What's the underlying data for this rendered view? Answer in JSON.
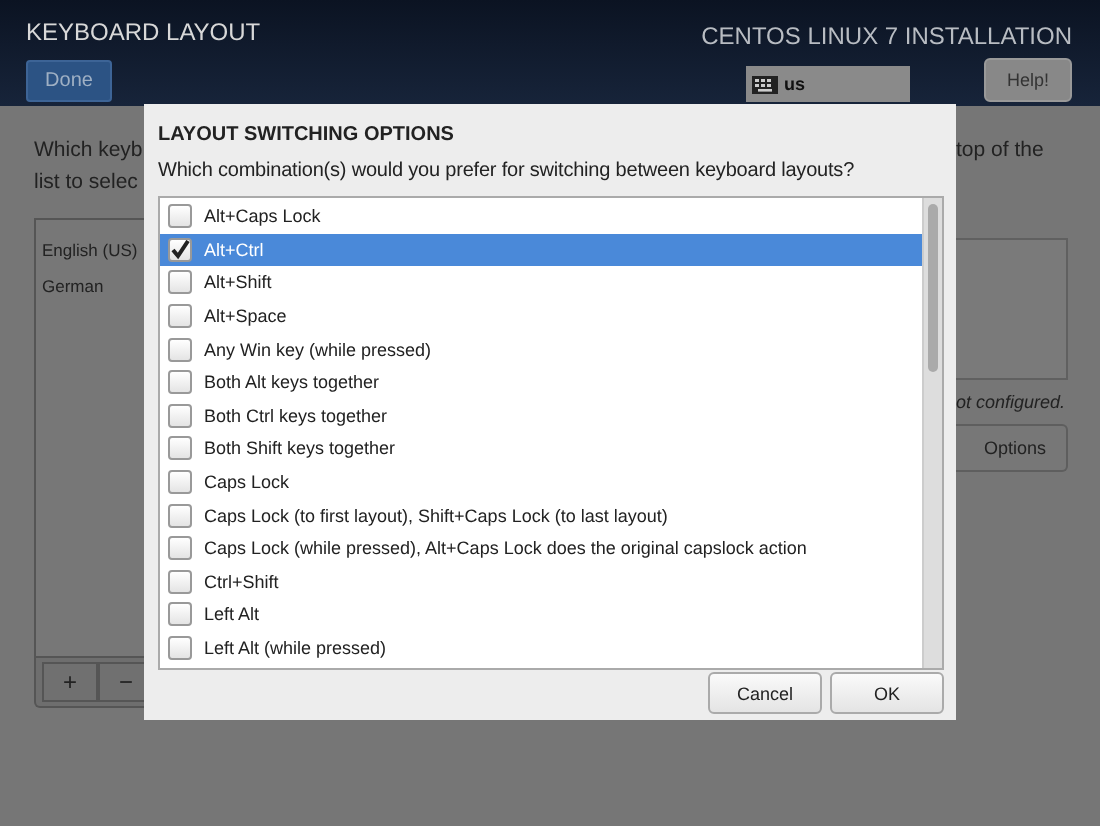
{
  "header": {
    "title": "KEYBOARD LAYOUT",
    "done_button": "Done",
    "product": "CENTOS LINUX 7 INSTALLATION",
    "keyboard_indicator": "us",
    "help_button": "Help!"
  },
  "background": {
    "intro_left": [
      "Which keyb",
      "list to selec"
    ],
    "intro_right": "top of the",
    "layouts": [
      {
        "label": "English (US)"
      },
      {
        "label": "German"
      }
    ],
    "toolbar": [
      "+",
      "−"
    ],
    "status": "ot configured.",
    "options_button": "Options"
  },
  "dialog": {
    "title": "LAYOUT SWITCHING OPTIONS",
    "question": "Which combination(s) would you prefer for switching between keyboard layouts?",
    "options": [
      {
        "label": "Alt+Caps Lock",
        "checked": false,
        "selected": false
      },
      {
        "label": "Alt+Ctrl",
        "checked": true,
        "selected": true
      },
      {
        "label": "Alt+Shift",
        "checked": false,
        "selected": false
      },
      {
        "label": "Alt+Space",
        "checked": false,
        "selected": false
      },
      {
        "label": "Any Win key (while pressed)",
        "checked": false,
        "selected": false
      },
      {
        "label": "Both Alt keys together",
        "checked": false,
        "selected": false
      },
      {
        "label": "Both Ctrl keys together",
        "checked": false,
        "selected": false
      },
      {
        "label": "Both Shift keys together",
        "checked": false,
        "selected": false
      },
      {
        "label": "Caps Lock",
        "checked": false,
        "selected": false
      },
      {
        "label": "Caps Lock (to first layout), Shift+Caps Lock (to last layout)",
        "checked": false,
        "selected": false
      },
      {
        "label": "Caps Lock (while pressed), Alt+Caps Lock does the original capslock action",
        "checked": false,
        "selected": false
      },
      {
        "label": "Ctrl+Shift",
        "checked": false,
        "selected": false
      },
      {
        "label": "Left Alt",
        "checked": false,
        "selected": false
      },
      {
        "label": "Left Alt (while pressed)",
        "checked": false,
        "selected": false
      }
    ],
    "buttons": [
      "Cancel",
      "OK"
    ]
  }
}
